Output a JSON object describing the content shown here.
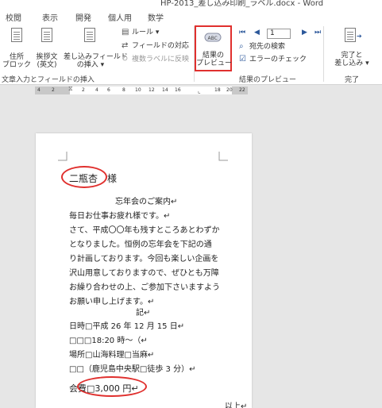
{
  "window": {
    "title": "HP-2013_差し込み印刷_ラベル.docx - Word"
  },
  "menu": {
    "tabs": [
      "校閲",
      "表示",
      "開発",
      "個人用",
      "数学"
    ]
  },
  "ribbon": {
    "group_write": {
      "address_block": "住所\nブロック",
      "greeting_line": "挨拶文\n(英文)",
      "insert_field": "差し込みフィールド\nの挿入 ▾",
      "rules": "ルール ▾",
      "match_fields": "フィールドの対応",
      "update_labels": "複数ラベルに反映",
      "label": "文章入力とフィールドの挿入"
    },
    "group_preview": {
      "preview_results": "結果の\nプレビュー",
      "record_number": "1",
      "find_recipient": "宛先の検索",
      "check_errors": "エラーのチェック",
      "label": "結果のプレビュー"
    },
    "group_finish": {
      "finish_merge": "完了と\n差し込み ▾",
      "label": "完了"
    }
  },
  "ruler": {
    "ticks": [
      "4",
      "2",
      "2",
      "4",
      "6",
      "8",
      "10",
      "12",
      "14",
      "16",
      "18",
      "20",
      "22"
    ]
  },
  "document": {
    "lines": [
      "二瓶杏　様",
      "忘年会のご案内↵",
      "毎日お仕事お疲れ様です。↵",
      "さて、平成〇〇年も残すところあとわずか",
      "となりました。恒例の忘年会を下記の通",
      "り計画しております。今回も楽しい企画を",
      "沢山用意しておりますので、ぜひとも万障",
      "お繰り合わせの上、ご参加下さいますよう",
      "お願い申し上げます。↵",
      "記↵",
      "日時□平成 26 年 12 月 15 日↵",
      "□□□18:20 時～（↵",
      "場所□山海料理□当麻↵",
      "□□（鹿児島中央駅□徒歩 3 分）↵",
      "会費□3,000 円↵",
      "以上↵"
    ]
  },
  "colors": {
    "highlight": "#e0302e",
    "accent": "#2b579a"
  }
}
